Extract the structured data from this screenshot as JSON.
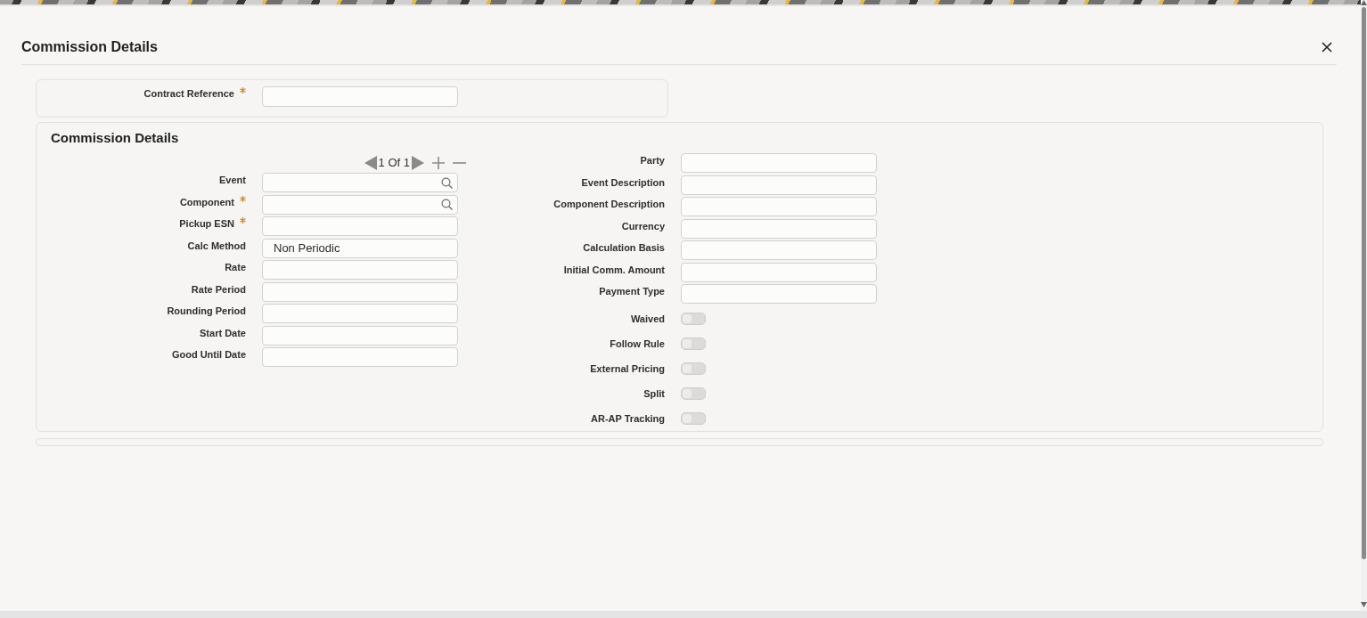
{
  "window": {
    "title": "Commission Details"
  },
  "header_fields": [
    {
      "label": "Contract Reference",
      "required": true,
      "kind": "text"
    }
  ],
  "section": {
    "title": "Commission Details",
    "pager": "1 Of 1",
    "left_fields": [
      {
        "label": "Event",
        "required": false,
        "kind": "lookup"
      },
      {
        "label": "Component",
        "required": true,
        "kind": "lookup"
      },
      {
        "label": "Pickup ESN",
        "required": true,
        "kind": "text"
      },
      {
        "label": "Calc Method",
        "required": false,
        "kind": "text",
        "value": "Non Periodic"
      },
      {
        "label": "Rate",
        "required": false,
        "kind": "text"
      },
      {
        "label": "Rate Period",
        "required": false,
        "kind": "text"
      },
      {
        "label": "Rounding Period",
        "required": false,
        "kind": "text"
      },
      {
        "label": "Start Date",
        "required": false,
        "kind": "text"
      },
      {
        "label": "Good Until Date",
        "required": false,
        "kind": "text"
      }
    ],
    "right_fields": [
      {
        "label": "Party",
        "required": false,
        "kind": "text"
      },
      {
        "label": "Event Description",
        "required": false,
        "kind": "text"
      },
      {
        "label": "Component Description",
        "required": false,
        "kind": "text"
      },
      {
        "label": "Currency",
        "required": false,
        "kind": "text"
      },
      {
        "label": "Calculation Basis",
        "required": false,
        "kind": "text"
      },
      {
        "label": "Initial Comm. Amount",
        "required": false,
        "kind": "text"
      },
      {
        "label": "Payment Type",
        "required": false,
        "kind": "text"
      },
      {
        "label": "Waived",
        "required": false,
        "kind": "toggle",
        "on": false
      },
      {
        "label": "Follow Rule",
        "required": false,
        "kind": "toggle",
        "on": false
      },
      {
        "label": "External Pricing",
        "required": false,
        "kind": "toggle",
        "on": false
      },
      {
        "label": "Split",
        "required": false,
        "kind": "toggle",
        "on": false
      },
      {
        "label": "AR-AP Tracking",
        "required": false,
        "kind": "toggle",
        "on": false
      }
    ]
  }
}
